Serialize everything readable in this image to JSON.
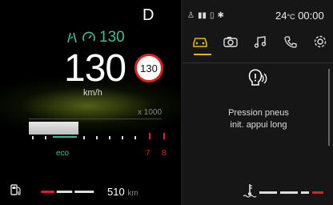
{
  "colors": {
    "accent_green": "#35c29a",
    "warning_red": "#e02020",
    "tab_active": "#e2b511"
  },
  "cluster": {
    "gear": "D",
    "acc_speed": "130",
    "speed": "130",
    "speed_limit": "130",
    "speed_unit": "km/h",
    "rpm_scale": "x 1000",
    "eco_label": "eco",
    "rpm_mark_7": "7",
    "rpm_mark_8": "8",
    "range_value": "510",
    "range_unit": "km"
  },
  "status_bar": {
    "temperature_value": "24",
    "temperature_unit": "°C",
    "time": "00:00"
  },
  "tabs": [
    {
      "icon": "car-icon",
      "active": true
    },
    {
      "icon": "camera-icon",
      "active": false
    },
    {
      "icon": "music-icon",
      "active": false
    },
    {
      "icon": "phone-icon",
      "active": false
    },
    {
      "icon": "settings-icon",
      "active": false
    }
  ],
  "panel": {
    "message_line1": "Pression pneus",
    "message_line2": "init. appui long"
  }
}
